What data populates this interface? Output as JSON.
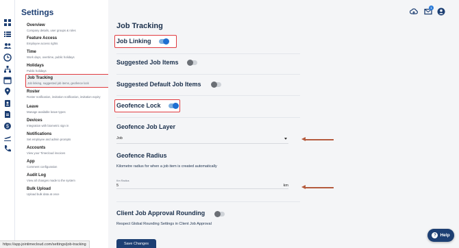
{
  "settings_menu": {
    "title": "Settings",
    "items": [
      {
        "label": "Overview",
        "desc": "Company details, user groups & roles"
      },
      {
        "label": "Feature Access",
        "desc": "Employee access rights"
      },
      {
        "label": "Time",
        "desc": "Work days, overtime, public holidays"
      },
      {
        "label": "Holidays",
        "desc": "Public holidays"
      },
      {
        "label": "Job Tracking",
        "desc": "Job linking, suggested job items, geofence lock"
      },
      {
        "label": "Roster",
        "desc": "Roster notification, invitation notification, invitation expiry"
      },
      {
        "label": "Leave",
        "desc": "Manage available leave types"
      },
      {
        "label": "Devices",
        "desc": "Integration with biometric sign in"
      },
      {
        "label": "Notifications",
        "desc": "Set employee and admin prompts"
      },
      {
        "label": "Accounts",
        "desc": "View your Timecloud invoices"
      },
      {
        "label": "App",
        "desc": "Comment configuration"
      },
      {
        "label": "Audit Log",
        "desc": "View all changes made to the system"
      },
      {
        "label": "Bulk Upload",
        "desc": "Upload bulk data at once"
      }
    ]
  },
  "main": {
    "title": "Job Tracking",
    "job_linking": {
      "label": "Job Linking",
      "enabled": true
    },
    "suggested_job_items": {
      "label": "Suggested Job Items",
      "enabled": false
    },
    "suggested_default_job_items": {
      "label": "Suggested Default Job Items",
      "enabled": false
    },
    "geofence_lock": {
      "label": "Geofence Lock",
      "enabled": true
    },
    "geofence_job_layer": {
      "label": "Geofence Job Layer",
      "selected": "Job"
    },
    "geofence_radius": {
      "label": "Geofence Radius",
      "description": "Kilometre radius for when a job item is created automatically",
      "field_label": "Km Radius",
      "value": "5",
      "unit": "km"
    },
    "client_job_approval_rounding": {
      "label": "Client Job Approval Rounding",
      "enabled": false,
      "description": "Respect Global Rounding Settings in Client Job Approval"
    },
    "save_label": "Save Changes"
  },
  "topbar": {
    "notification_count": "1"
  },
  "help_label": "Help",
  "status_url": "https://app.jointimecloud.com/settings/job-tracking",
  "colors": {
    "brand": "#1d3f73",
    "toggle_on": "#1f6fd1",
    "highlight": "#e0393e",
    "arrow": "#b45a3c"
  },
  "icons": [
    "dashboard-icon",
    "list-icon",
    "users-icon",
    "clock-icon",
    "org-chart-icon",
    "calendar-icon",
    "location-pin-icon",
    "contacts-icon",
    "document-icon",
    "dollar-icon",
    "plane-icon",
    "phone-icon",
    "upload-cloud-icon",
    "mail-icon",
    "user-circle-icon"
  ]
}
